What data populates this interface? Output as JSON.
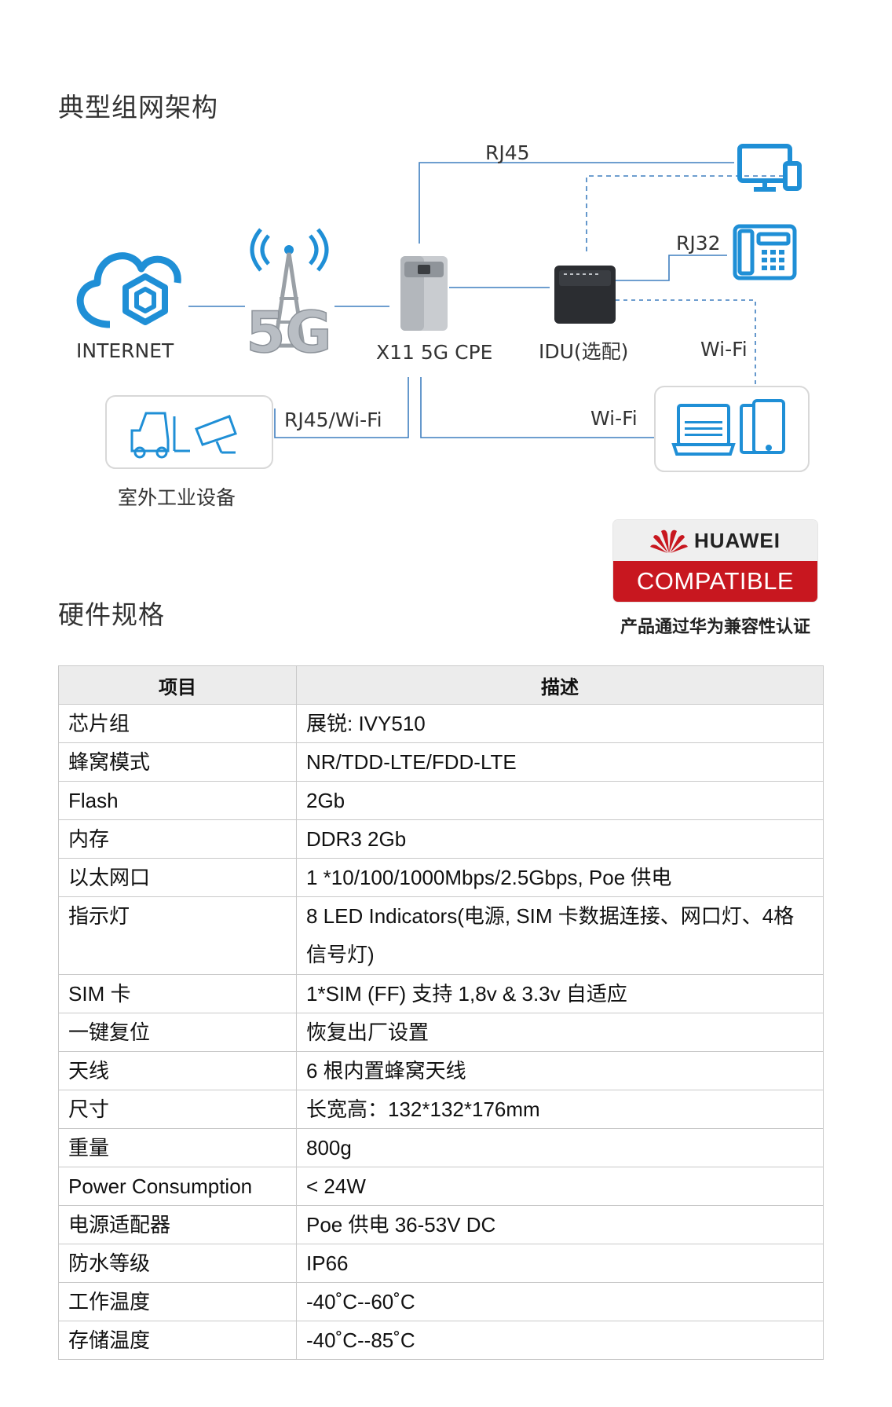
{
  "sections": {
    "architecture_title": "典型组网架构",
    "hardware_title": "硬件规格"
  },
  "diagram": {
    "rj45_top": "RJ45",
    "rj32": "RJ32",
    "internet": "INTERNET",
    "cpe": "X11 5G CPE",
    "idu": "IDU(选配)",
    "wifi_right": "Wi-Fi",
    "rj45_wifi": "RJ45/Wi-Fi",
    "wifi_bottom": "Wi-Fi",
    "outdoor": "室外工业设备",
    "tower_text": "5G"
  },
  "badge": {
    "brand": "HUAWEI",
    "compatible": "COMPATIBLE",
    "caption": "产品通过华为兼容性认证",
    "brand_color": "#c8171f"
  },
  "table": {
    "headers": [
      "项目",
      "描述"
    ],
    "rows": [
      [
        "芯片组",
        "展锐: IVY510"
      ],
      [
        "蜂窝模式",
        "NR/TDD-LTE/FDD-LTE"
      ],
      [
        "Flash",
        "2Gb"
      ],
      [
        "内存",
        "DDR3 2Gb"
      ],
      [
        "以太网口",
        "1 *10/100/1000Mbps/2.5Gbps, Poe 供电"
      ],
      [
        "指示灯",
        "8 LED Indicators(电源, SIM 卡数据连接、网口灯、4格信号灯)"
      ],
      [
        "SIM 卡",
        "1*SIM (FF) 支持 1,8v & 3.3v 自适应"
      ],
      [
        "一键复位",
        "恢复出厂设置"
      ],
      [
        "天线",
        "6 根内置蜂窝天线"
      ],
      [
        "尺寸",
        "长宽高：132*132*176mm"
      ],
      [
        "重量",
        "800g"
      ],
      [
        "Power Consumption",
        "< 24W"
      ],
      [
        "电源适配器",
        "Poe 供电 36-53V DC"
      ],
      [
        "防水等级",
        "IP66"
      ],
      [
        "工作温度",
        "-40˚C--60˚C"
      ],
      [
        "存储温度",
        "-40˚C--85˚C"
      ]
    ]
  },
  "colors": {
    "line": "#3f7fbf",
    "icon_blue": "#1f8fd6"
  }
}
